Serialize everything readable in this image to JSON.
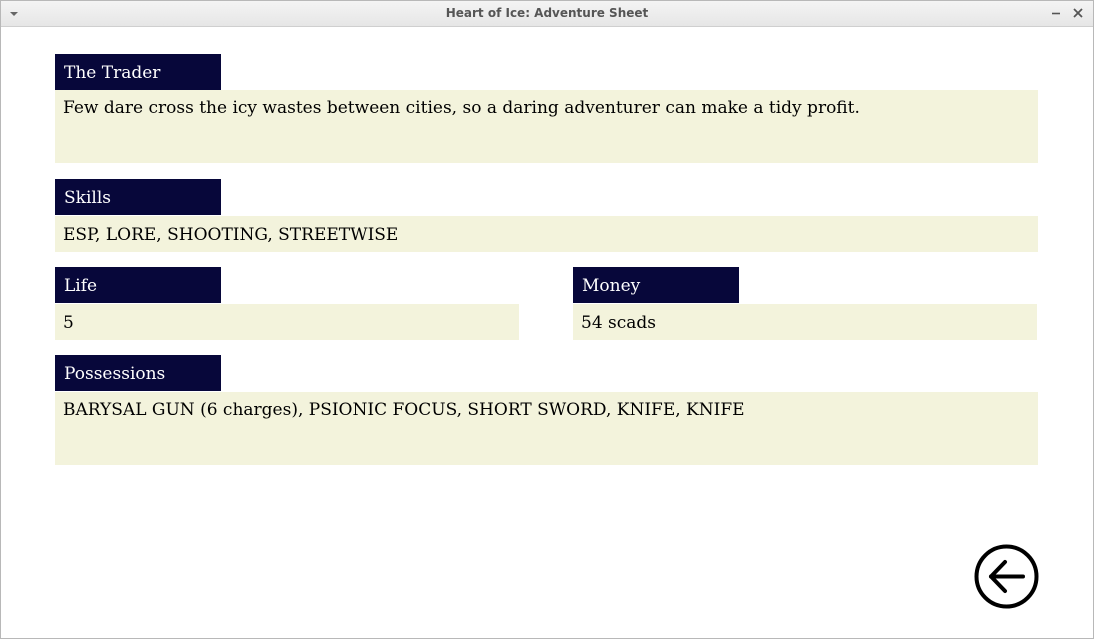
{
  "window": {
    "title": "Heart of Ice: Adventure Sheet"
  },
  "profession": {
    "name": "The Trader",
    "description": "Few dare cross the icy wastes between cities, so a daring adventurer can make a tidy profit."
  },
  "skills": {
    "label": "Skills",
    "value": "ESP, LORE, SHOOTING, STREETWISE"
  },
  "life": {
    "label": "Life",
    "value": "5"
  },
  "money": {
    "label": "Money",
    "value": "54 scads"
  },
  "possessions": {
    "label": "Possessions",
    "value": "BARYSAL GUN (6 charges), PSIONIC FOCUS, SHORT SWORD, KNIFE, KNIFE"
  },
  "icons": {
    "back": "back-arrow-icon",
    "menu": "chevron-down-icon",
    "minimize": "minimize-icon",
    "close": "close-icon"
  },
  "colors": {
    "header_bg": "#07073a",
    "header_text": "#ffffff",
    "box_bg": "#f3f3dc"
  }
}
